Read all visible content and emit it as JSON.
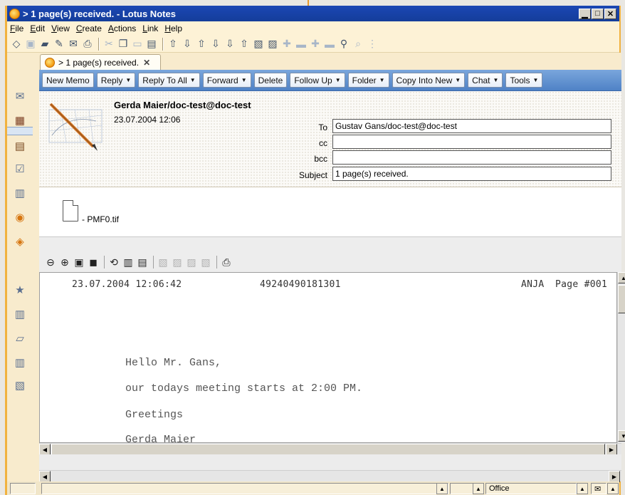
{
  "window": {
    "title": "> 1 page(s) received. - Lotus Notes",
    "controls": {
      "minimize": "▁",
      "maximize": "□",
      "close": "✕"
    }
  },
  "menu": [
    "File",
    "Edit",
    "View",
    "Create",
    "Actions",
    "Link",
    "Help"
  ],
  "tab": {
    "label": "> 1 page(s) received.",
    "close": "✕"
  },
  "actions": [
    {
      "label": "New Memo",
      "dropdown": false
    },
    {
      "label": "Reply",
      "dropdown": true
    },
    {
      "label": "Reply To All",
      "dropdown": true
    },
    {
      "label": "Forward",
      "dropdown": true
    },
    {
      "label": "Delete",
      "dropdown": false
    },
    {
      "label": "Follow Up",
      "dropdown": true
    },
    {
      "label": "Folder",
      "dropdown": true
    },
    {
      "label": "Copy Into New",
      "dropdown": true
    },
    {
      "label": "Chat",
      "dropdown": true
    },
    {
      "label": "Tools",
      "dropdown": true
    }
  ],
  "dropdown_arrow": "▼",
  "memo": {
    "from": "Gerda Maier/doc-test@doc-test",
    "date": "23.07.2004 12:06",
    "labels": {
      "to": "To",
      "cc": "cc",
      "bcc": "bcc",
      "subject": "Subject"
    },
    "to": "Gustav Gans/doc-test@doc-test",
    "cc": "",
    "bcc": "",
    "subject": "1 page(s) received."
  },
  "attachment": {
    "name": "- PMF0.tif"
  },
  "fax": {
    "timestamp": "23.07.2004 12:06:42",
    "number": "49240490181301",
    "sender_id": "ANJA",
    "page": "Page #001",
    "lines": [
      "Hello Mr. Gans,",
      "our todays meeting starts at 2:00 PM.",
      "Greetings",
      "Gerda Maier"
    ]
  },
  "status": {
    "location": "Office"
  },
  "colors": {
    "title_bar": "#1b47b4",
    "action_bar": "#4f82c6",
    "frame_accent": "#f1b23f",
    "app_bg": "#f8ebcd"
  }
}
